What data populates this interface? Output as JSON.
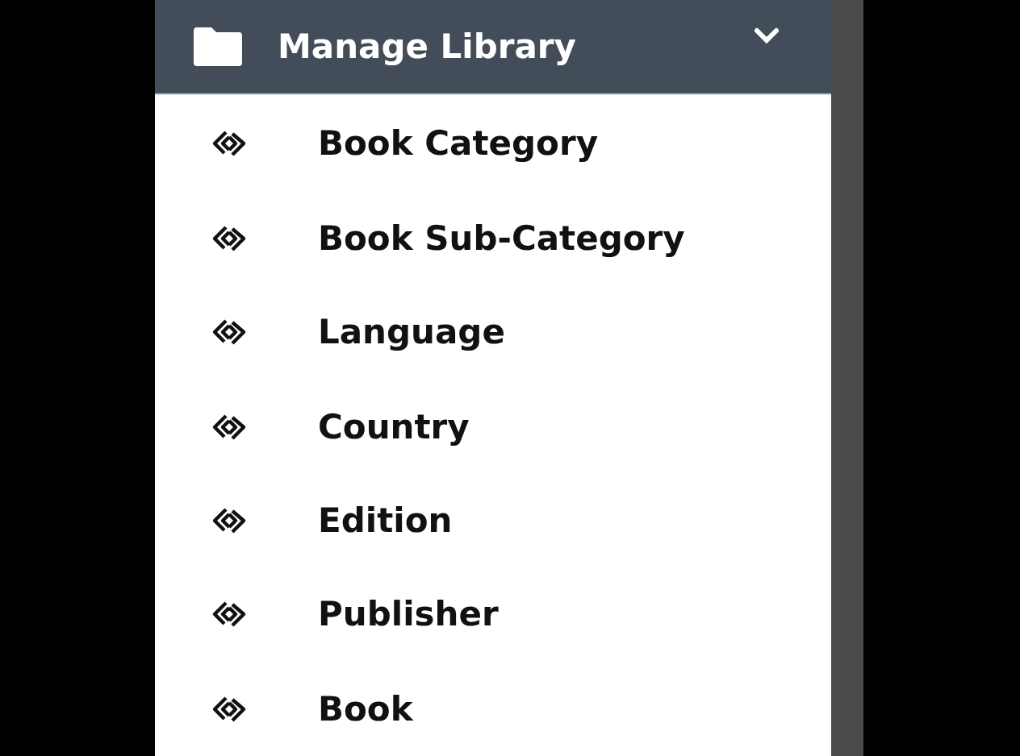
{
  "menu": {
    "title": "Manage Library",
    "expanded": true,
    "items": [
      {
        "label": "Book Category"
      },
      {
        "label": "Book Sub-Category"
      },
      {
        "label": "Language"
      },
      {
        "label": "Country"
      },
      {
        "label": "Edition"
      },
      {
        "label": "Publisher"
      },
      {
        "label": "Book"
      }
    ]
  }
}
